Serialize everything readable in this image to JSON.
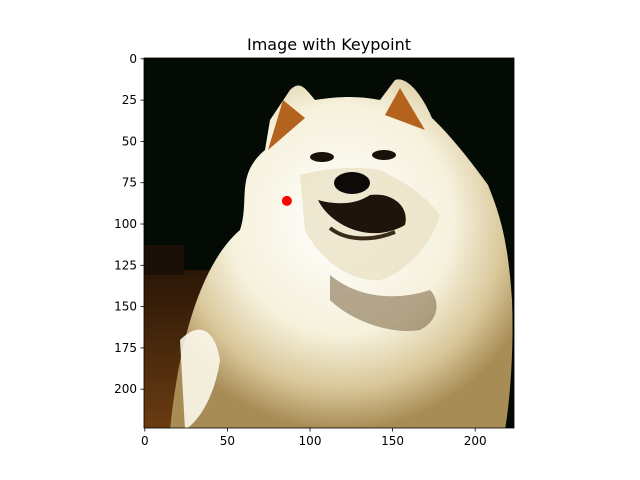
{
  "chart_data": {
    "type": "scatter",
    "title": "Image with Keypoint",
    "xlabel": "",
    "ylabel": "",
    "xlim": [
      -0.5,
      223.5
    ],
    "ylim": [
      223.5,
      -0.5
    ],
    "y_inverted": true,
    "grid": false,
    "legend": "none",
    "background_image": "samoyed-dog-photo",
    "x_ticks": [
      0,
      50,
      100,
      150,
      200
    ],
    "y_ticks": [
      0,
      25,
      50,
      75,
      100,
      125,
      150,
      175,
      200
    ],
    "x_tick_labels": [
      "0",
      "50",
      "100",
      "150",
      "200"
    ],
    "y_tick_labels": [
      "0",
      "25",
      "50",
      "75",
      "100",
      "125",
      "150",
      "175",
      "200"
    ],
    "series": [
      {
        "points": [
          {
            "x": 86,
            "y": 86
          }
        ],
        "color": "#ff0000",
        "marker": "circle"
      }
    ]
  }
}
